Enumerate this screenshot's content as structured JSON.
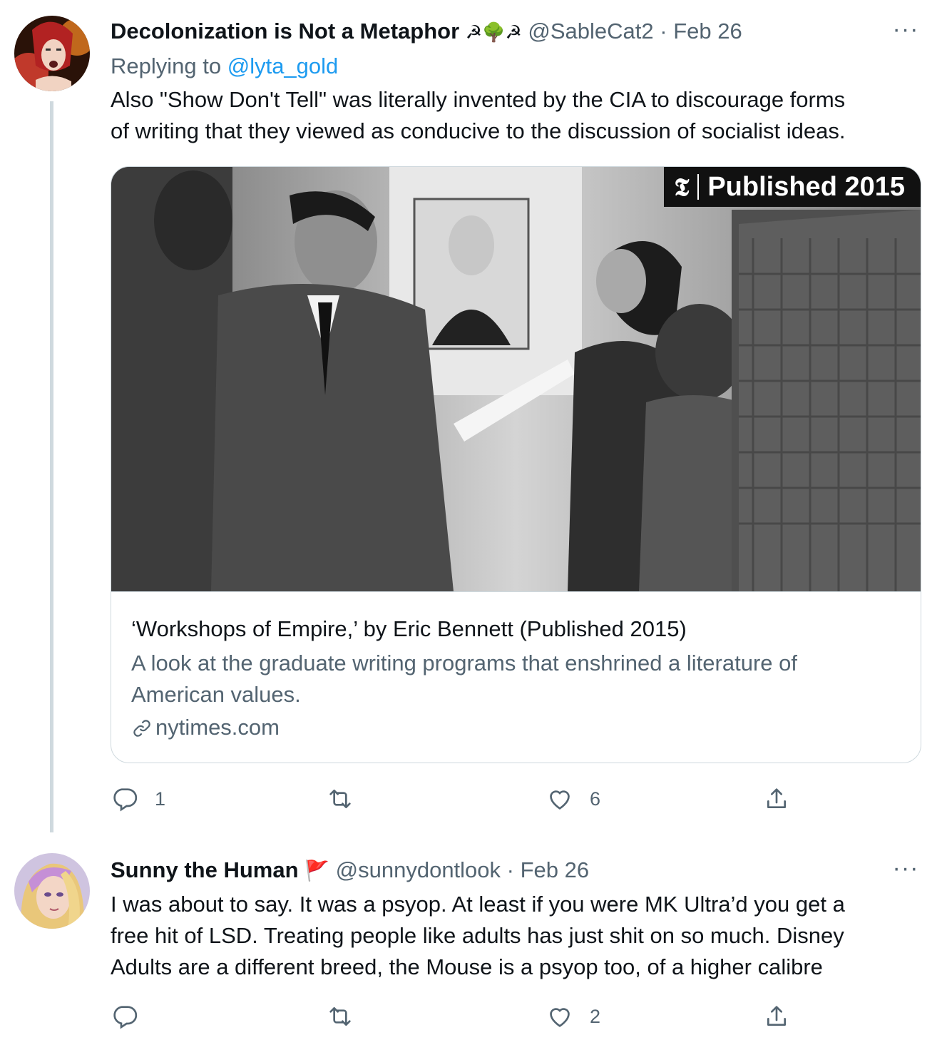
{
  "tweets": [
    {
      "name": "Decolonization is Not a Metaphor",
      "name_emoji": "☭🌳☭",
      "handle": "@SableCat2",
      "separator": "·",
      "date": "Feb 26",
      "more": "···",
      "replying_prefix": "Replying to",
      "replying_to": "@lyta_gold",
      "body_lines": [
        "Also \"Show Don't Tell\" was literally invented by the CIA to discourage forms",
        "of writing that they viewed as conducive to the discussion of socialist ideas."
      ],
      "card": {
        "badge_logo": "𝕿",
        "badge_text": "Published 2015",
        "title": "‘Workshops of Empire,’ by Eric Bennett (Published 2015)",
        "description_lines": [
          "A look at the graduate writing programs that enshrined a literature of",
          "American values."
        ],
        "domain": "nytimes.com",
        "domain_icon": "link-icon"
      },
      "actions": {
        "reply_count": "1",
        "retweet_count": "",
        "like_count": "6"
      }
    },
    {
      "name": "Sunny the Human",
      "name_emoji": "🚩",
      "handle": "@sunnydontlook",
      "separator": "·",
      "date": "Feb 26",
      "more": "···",
      "body_lines": [
        "I was about to say. It was a psyop. At least if you were MK Ultra’d you get a",
        "free hit of LSD.   Treating people like adults has just shit on so much. Disney",
        "Adults are a different breed, the Mouse is a psyop too, of a higher calibre"
      ],
      "actions": {
        "reply_count": "",
        "retweet_count": "",
        "like_count": "2"
      }
    }
  ],
  "colors": {
    "text": "#0f1419",
    "secondary": "#536471",
    "link": "#1d9bf0",
    "border": "#cfd9de",
    "flag": "#e0245e"
  }
}
